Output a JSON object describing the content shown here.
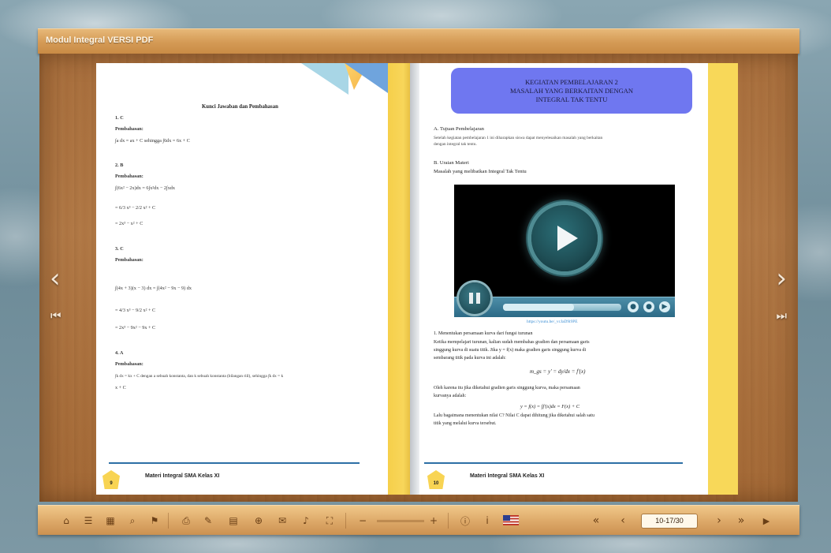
{
  "app": {
    "title": "Modul Integral VERSI PDF"
  },
  "left_page": {
    "heading": "Kunci Jawaban dan Pembahasan",
    "lines": [
      "1.  C",
      "Pembahasan:",
      "∫a dx = ax + C sehingga ∫6dx = 6x + C",
      "2.  B",
      "Pembahasan:",
      "∫(6x² − 2x)dx = 6∫x²dx − 2∫xdx",
      "= 6/3 x³ − 2/2 x² + C",
      "= 2x³ − x² + C",
      "3.  C",
      "Pembahasan:",
      "∫(4x + 3)(x − 3) dx = ∫(4x² − 9x − 9) dx",
      "= 4/3 x³ − 9/2 x² + C",
      "= 2x³ − 9x² − 9x + C",
      "4.  A",
      "Pembahasan:",
      "∫k dx = kx + C dengan a sebuah konstanta, dan k sebuah konstanta (bilangan riil), sehingga ∫k dx = k",
      "x + C"
    ],
    "footer_title": "Materi Integral SMA Kelas XI",
    "page_number": "9"
  },
  "right_page": {
    "header_lines": [
      "KEGIATAN PEMBELAJARAN 2",
      "MASALAH YANG BERKAITAN DENGAN",
      "INTEGRAL TAK TENTU"
    ],
    "section_a_title": "A.   Tujuan Pembelajaran",
    "section_a_text_1": "Setelah kegiatan pembelajaran 1 ini diharapkan siswa dapat menyelesaikan masalah yang berkaitan",
    "section_a_text_2": "dengan integral tak tentu.",
    "section_b_title": "B. Uraian Materi",
    "section_b_text": "Masalah yang melibatkan Integral Tak Tentu",
    "video_link": "https://youtu.be/_vcJaD9i9PE",
    "video_progress": 0.6,
    "item_1_title": "1.      Menentukan persamaan kurva dari fungsi turunan",
    "paragraph_1": [
      "Ketika mempelajari turunan, kalian sudah membahas gradien dan persamaan garis",
      "singgung kurva di suatu titik. Jika y = f(x) maka gradien garis singgung kurva di",
      "sembarang titik pada kurva ini adalah:"
    ],
    "formula_1": "m_gs = y' = dy/dx = f'(x)",
    "paragraph_2": [
      "Oleh karena itu jika diketahui gradien garis singgung kurva, maka persamaan",
      "kurvanya adalah:"
    ],
    "formula_2": "y = f(x) = ∫f'(x)dx = F(x) + C",
    "paragraph_3": [
      "Lalu bagaimana menentukan nilai C? Nilai C dapat dihitung jika diketahui salah satu",
      "titik yang melalui kurva tersebut."
    ],
    "footer_title": "Materi Integral SMA Kelas XI",
    "page_number": "10"
  },
  "toolbar": {
    "page_field": "10-17/30",
    "icons": [
      "home-icon",
      "table-of-contents-icon",
      "thumbnails-icon",
      "search-icon",
      "bookmark-icon",
      "print-icon",
      "annotate-icon",
      "note-icon",
      "share-icon",
      "email-icon",
      "sound-icon",
      "fullscreen-icon",
      "zoom-out-icon",
      "zoom-in-icon",
      "help-icon",
      "info-icon",
      "language-icon",
      "first-page-icon",
      "previous-page-icon",
      "next-page-icon",
      "last-page-icon",
      "autoplay-icon"
    ]
  },
  "colors": {
    "title_bar": "#d49a55",
    "wood": "#a9703e",
    "header_box": "#6f77f0",
    "spine_yellow": "#f8d859",
    "footer_line": "#2d6fa5"
  }
}
